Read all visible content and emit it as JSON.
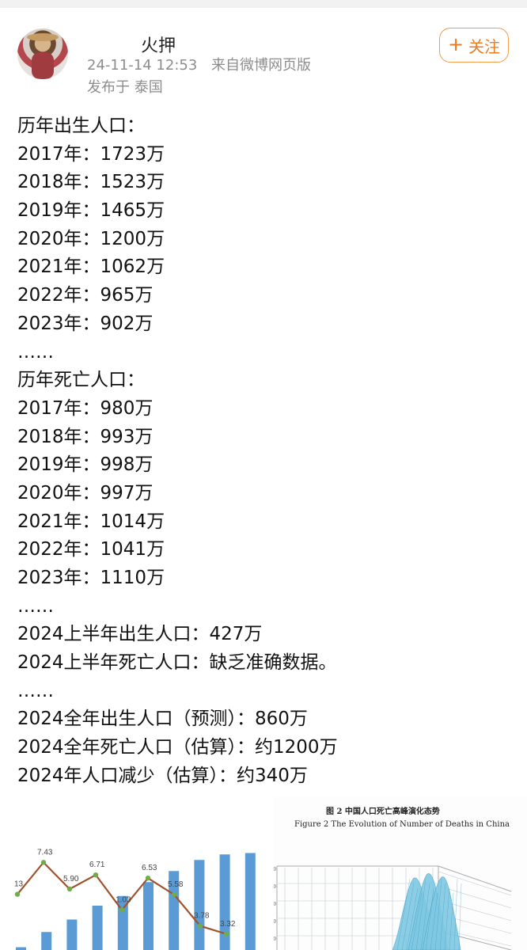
{
  "post": {
    "username": "火押",
    "time": "24-11-14 12:53",
    "source": "来自微博网页版",
    "location": "发布于 泰国",
    "follow_label": "关注",
    "follow_icon": "plus-icon"
  },
  "content_lines": [
    "历年出生人口：",
    "2017年：1723万",
    "2018年：1523万",
    "2019年：1465万",
    "2020年：1200万",
    "2021年：1062万",
    "2022年：965万",
    "2023年：902万",
    "……",
    "历年死亡人口：",
    "2017年：980万",
    "2018年：993万",
    "2019年：998万",
    "2020年：997万",
    "2021年：1014万",
    "2022年：1041万",
    "2023年：1110万",
    "……",
    "2024上半年出生人口：427万",
    "2024上半年死亡人口：缺乏准确数据。",
    "……",
    "2024全年出生人口（预测）：860万",
    "2024全年死亡人口（估算）：约1200万",
    "2024年人口减少（估算）：约340万"
  ],
  "image1": {
    "line_labels": [
      "13",
      "7.43",
      "5.90",
      "6.71",
      "1.03",
      "6.53",
      "5.58",
      "3.78",
      "3.32"
    ],
    "line_values": [
      5.6,
      7.43,
      5.9,
      6.71,
      4.7,
      6.53,
      5.58,
      3.78,
      3.32
    ],
    "bar_values": [
      0.2,
      1.3,
      2.2,
      3.2,
      3.9,
      4.9,
      5.7,
      6.5,
      6.9,
      7.0
    ],
    "colors": {
      "bar": "#5b9bd5",
      "line": "#a0522d",
      "marker": "#70ad47"
    }
  },
  "image2": {
    "title": "图 2   中国人口死亡高峰演化态势",
    "subtitle": "Figure 2   The Evolution of Number of Deaths in China",
    "axis_ticks": [
      "20",
      "10",
      "10",
      "10",
      "10"
    ],
    "colors": {
      "surface": "#7ec8e3",
      "grid": "#cfd8dc"
    }
  }
}
